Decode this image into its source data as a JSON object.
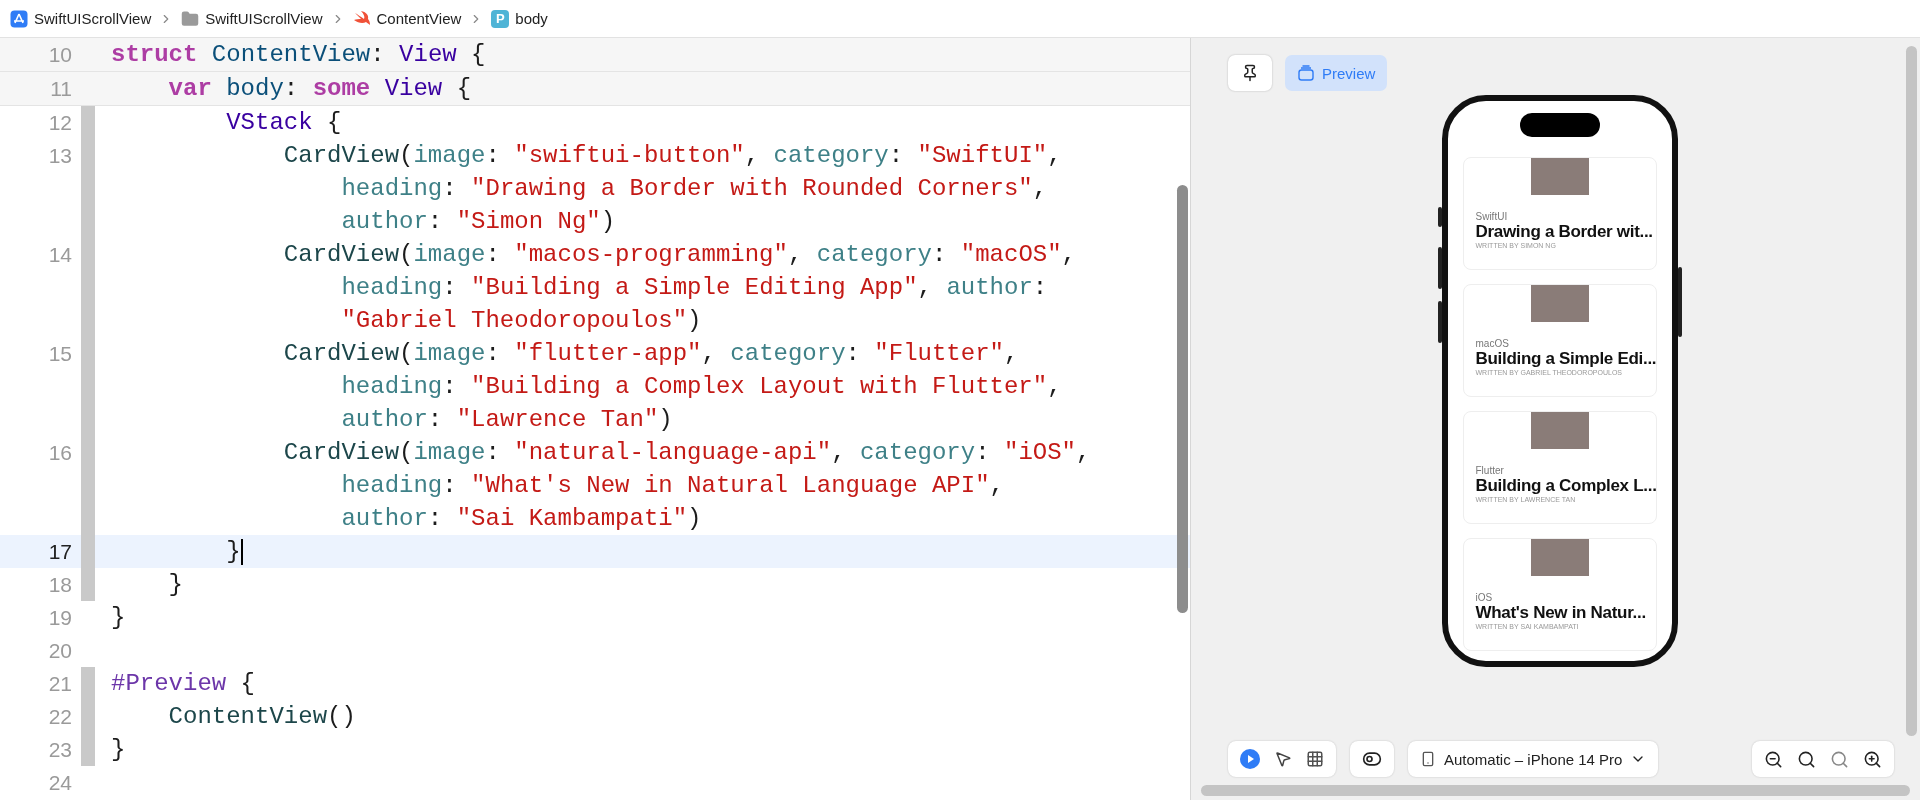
{
  "breadcrumb": [
    {
      "kind": "app",
      "label": "SwiftUIScrollView"
    },
    {
      "kind": "folder",
      "label": "SwiftUIScrollView"
    },
    {
      "kind": "swift",
      "label": "ContentView"
    },
    {
      "kind": "property",
      "badge": "P",
      "label": "body"
    }
  ],
  "editor": {
    "lines": [
      {
        "number": "10",
        "sticky": true,
        "ribbon": false,
        "current": false,
        "tokens": [
          {
            "kind": "keyword",
            "text": "struct "
          },
          {
            "kind": "decl",
            "text": "ContentView"
          },
          {
            "kind": "plain",
            "text": ": "
          },
          {
            "kind": "type",
            "text": "View"
          },
          {
            "kind": "plain",
            "text": " {"
          }
        ]
      },
      {
        "number": "11",
        "sticky": true,
        "ribbon": false,
        "current": false,
        "tokens": [
          {
            "kind": "keyword",
            "text": "    var "
          },
          {
            "kind": "decl",
            "text": "body"
          },
          {
            "kind": "plain",
            "text": ": "
          },
          {
            "kind": "keyword",
            "text": "some "
          },
          {
            "kind": "type",
            "text": "View"
          },
          {
            "kind": "plain",
            "text": " {"
          }
        ]
      },
      {
        "number": "12",
        "sticky": false,
        "ribbon": true,
        "current": false,
        "tokens": [
          {
            "kind": "type",
            "text": "        VStack"
          },
          {
            "kind": "plain",
            "text": " {"
          }
        ]
      },
      {
        "number": "13",
        "sticky": false,
        "ribbon": true,
        "current": false,
        "tokens": [
          {
            "kind": "project",
            "text": "            CardView"
          },
          {
            "kind": "plain",
            "text": "("
          },
          {
            "kind": "param",
            "text": "image"
          },
          {
            "kind": "plain",
            "text": ": "
          },
          {
            "kind": "string",
            "text": "\"swiftui-button\""
          },
          {
            "kind": "plain",
            "text": ", "
          },
          {
            "kind": "param",
            "text": "category"
          },
          {
            "kind": "plain",
            "text": ": "
          },
          {
            "kind": "string",
            "text": "\"SwiftUI\""
          },
          {
            "kind": "plain",
            "text": ","
          },
          {
            "kind": "wrap"
          },
          {
            "kind": "param",
            "text": "                heading"
          },
          {
            "kind": "plain",
            "text": ": "
          },
          {
            "kind": "string",
            "text": "\"Drawing a Border with Rounded Corners\""
          },
          {
            "kind": "plain",
            "text": ","
          },
          {
            "kind": "wrap"
          },
          {
            "kind": "param",
            "text": "                author"
          },
          {
            "kind": "plain",
            "text": ": "
          },
          {
            "kind": "string",
            "text": "\"Simon Ng\""
          },
          {
            "kind": "plain",
            "text": ")"
          }
        ]
      },
      {
        "number": "14",
        "sticky": false,
        "ribbon": true,
        "current": false,
        "tokens": [
          {
            "kind": "project",
            "text": "            CardView"
          },
          {
            "kind": "plain",
            "text": "("
          },
          {
            "kind": "param",
            "text": "image"
          },
          {
            "kind": "plain",
            "text": ": "
          },
          {
            "kind": "string",
            "text": "\"macos-programming\""
          },
          {
            "kind": "plain",
            "text": ", "
          },
          {
            "kind": "param",
            "text": "category"
          },
          {
            "kind": "plain",
            "text": ": "
          },
          {
            "kind": "string",
            "text": "\"macOS\""
          },
          {
            "kind": "plain",
            "text": ","
          },
          {
            "kind": "wrap"
          },
          {
            "kind": "param",
            "text": "                heading"
          },
          {
            "kind": "plain",
            "text": ": "
          },
          {
            "kind": "string",
            "text": "\"Building a Simple Editing App\""
          },
          {
            "kind": "plain",
            "text": ", "
          },
          {
            "kind": "param",
            "text": "author"
          },
          {
            "kind": "plain",
            "text": ":"
          },
          {
            "kind": "wrap"
          },
          {
            "kind": "string",
            "text": "                \"Gabriel Theodoropoulos\""
          },
          {
            "kind": "plain",
            "text": ")"
          }
        ]
      },
      {
        "number": "15",
        "sticky": false,
        "ribbon": true,
        "current": false,
        "tokens": [
          {
            "kind": "project",
            "text": "            CardView"
          },
          {
            "kind": "plain",
            "text": "("
          },
          {
            "kind": "param",
            "text": "image"
          },
          {
            "kind": "plain",
            "text": ": "
          },
          {
            "kind": "string",
            "text": "\"flutter-app\""
          },
          {
            "kind": "plain",
            "text": ", "
          },
          {
            "kind": "param",
            "text": "category"
          },
          {
            "kind": "plain",
            "text": ": "
          },
          {
            "kind": "string",
            "text": "\"Flutter\""
          },
          {
            "kind": "plain",
            "text": ","
          },
          {
            "kind": "wrap"
          },
          {
            "kind": "param",
            "text": "                heading"
          },
          {
            "kind": "plain",
            "text": ": "
          },
          {
            "kind": "string",
            "text": "\"Building a Complex Layout with Flutter\""
          },
          {
            "kind": "plain",
            "text": ","
          },
          {
            "kind": "wrap"
          },
          {
            "kind": "param",
            "text": "                author"
          },
          {
            "kind": "plain",
            "text": ": "
          },
          {
            "kind": "string",
            "text": "\"Lawrence Tan\""
          },
          {
            "kind": "plain",
            "text": ")"
          }
        ]
      },
      {
        "number": "16",
        "sticky": false,
        "ribbon": true,
        "current": false,
        "tokens": [
          {
            "kind": "project",
            "text": "            CardView"
          },
          {
            "kind": "plain",
            "text": "("
          },
          {
            "kind": "param",
            "text": "image"
          },
          {
            "kind": "plain",
            "text": ": "
          },
          {
            "kind": "string",
            "text": "\"natural-language-api\""
          },
          {
            "kind": "plain",
            "text": ", "
          },
          {
            "kind": "param",
            "text": "category"
          },
          {
            "kind": "plain",
            "text": ": "
          },
          {
            "kind": "string",
            "text": "\"iOS\""
          },
          {
            "kind": "plain",
            "text": ","
          },
          {
            "kind": "wrap"
          },
          {
            "kind": "param",
            "text": "                heading"
          },
          {
            "kind": "plain",
            "text": ": "
          },
          {
            "kind": "string",
            "text": "\"What's New in Natural Language API\""
          },
          {
            "kind": "plain",
            "text": ","
          },
          {
            "kind": "wrap"
          },
          {
            "kind": "param",
            "text": "                author"
          },
          {
            "kind": "plain",
            "text": ": "
          },
          {
            "kind": "string",
            "text": "\"Sai Kambampati\""
          },
          {
            "kind": "plain",
            "text": ")"
          }
        ]
      },
      {
        "number": "17",
        "sticky": false,
        "ribbon": true,
        "current": true,
        "tokens": [
          {
            "kind": "plain",
            "text": "        }"
          }
        ]
      },
      {
        "number": "18",
        "sticky": false,
        "ribbon": true,
        "current": false,
        "tokens": [
          {
            "kind": "plain",
            "text": "    }"
          }
        ]
      },
      {
        "number": "19",
        "sticky": false,
        "ribbon": false,
        "current": false,
        "tokens": [
          {
            "kind": "plain",
            "text": "}"
          }
        ]
      },
      {
        "number": "20",
        "sticky": false,
        "ribbon": false,
        "current": false
      },
      {
        "number": "21",
        "sticky": false,
        "ribbon": true,
        "current": false,
        "tokens": [
          {
            "kind": "macro",
            "text": "#Preview"
          },
          {
            "kind": "plain",
            "text": " {"
          }
        ]
      },
      {
        "number": "22",
        "sticky": false,
        "ribbon": true,
        "current": false,
        "tokens": [
          {
            "kind": "project",
            "text": "    ContentView"
          },
          {
            "kind": "plain",
            "text": "()"
          }
        ]
      },
      {
        "number": "23",
        "sticky": false,
        "ribbon": true,
        "current": false,
        "tokens": [
          {
            "kind": "plain",
            "text": "}"
          }
        ]
      },
      {
        "number": "24",
        "sticky": false,
        "ribbon": false,
        "current": false
      }
    ]
  },
  "preview": {
    "pin": {
      "selected": false
    },
    "preview_button": {
      "label": "Preview",
      "selected": true
    },
    "cards": [
      {
        "category": "SwiftUI",
        "heading": "Drawing a Border wit...",
        "author": "WRITTEN BY SIMON NG"
      },
      {
        "category": "macOS",
        "heading": "Building a Simple Edi...",
        "author": "WRITTEN BY GABRIEL THEODOROPOULOS"
      },
      {
        "category": "Flutter",
        "heading": "Building a Complex L...",
        "author": "WRITTEN BY LAWRENCE TAN"
      },
      {
        "category": "iOS",
        "heading": "What's New in Natur...",
        "author": "WRITTEN BY SAI KAMBAMPATI"
      }
    ],
    "modes": [
      {
        "kind": "live",
        "selected": true
      },
      {
        "kind": "select",
        "selected": false
      },
      {
        "kind": "variants",
        "selected": false
      }
    ],
    "device": "Automatic – iPhone 14 Pro",
    "zoom": [
      {
        "kind": "out"
      },
      {
        "kind": "actual"
      },
      {
        "kind": "fit"
      },
      {
        "kind": "in"
      }
    ]
  }
}
